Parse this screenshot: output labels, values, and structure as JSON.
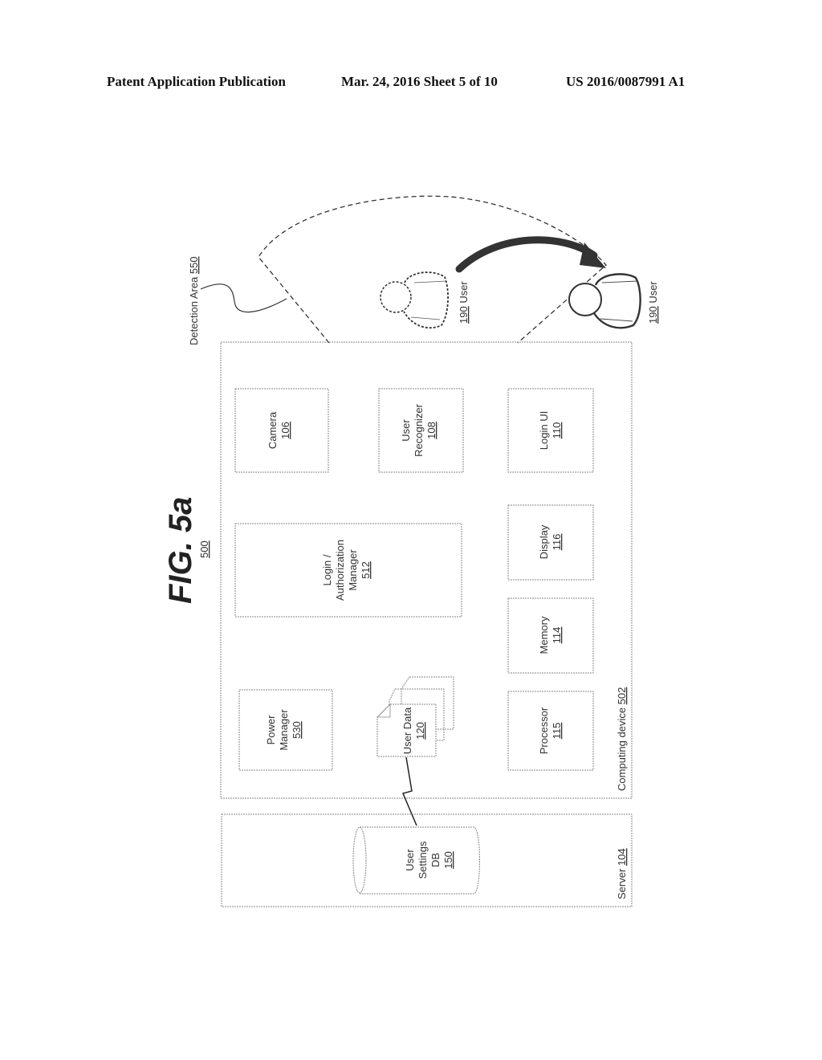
{
  "header": {
    "left": "Patent Application Publication",
    "middle": "Mar. 24, 2016  Sheet 5 of 10",
    "right": "US 2016/0087991 A1"
  },
  "figure": {
    "title": "FIG. 5a",
    "ref": "500"
  },
  "detection_area": {
    "label": "Detection Area ",
    "ref": "550"
  },
  "users": [
    {
      "ref": "190",
      "label": " User",
      "state": "dashed-outline"
    },
    {
      "ref": "190",
      "label": " User",
      "state": "solid-outline"
    }
  ],
  "computing_device": {
    "label": "Computing device ",
    "ref": "502"
  },
  "components": {
    "camera": {
      "lines": [
        "Camera"
      ],
      "ref": "106"
    },
    "user_recognizer": {
      "lines": [
        "User",
        "Recognizer"
      ],
      "ref": "108"
    },
    "login_ui": {
      "lines": [
        "Login UI"
      ],
      "ref": "110"
    },
    "login_manager": {
      "lines": [
        "Login /",
        "Authorization",
        "Manager"
      ],
      "ref": "512"
    },
    "display": {
      "lines": [
        "Display"
      ],
      "ref": "116"
    },
    "memory": {
      "lines": [
        "Memory"
      ],
      "ref": "114"
    },
    "power_manager": {
      "lines": [
        "Power",
        "Manager"
      ],
      "ref": "530"
    },
    "user_data": {
      "lines": [
        "User Data"
      ],
      "ref": "120"
    },
    "processor": {
      "lines": [
        "Processor"
      ],
      "ref": "115"
    }
  },
  "server": {
    "label": "Server ",
    "ref": "104"
  },
  "database": {
    "lines": [
      "User",
      "Settings",
      "DB"
    ],
    "ref": "150"
  }
}
